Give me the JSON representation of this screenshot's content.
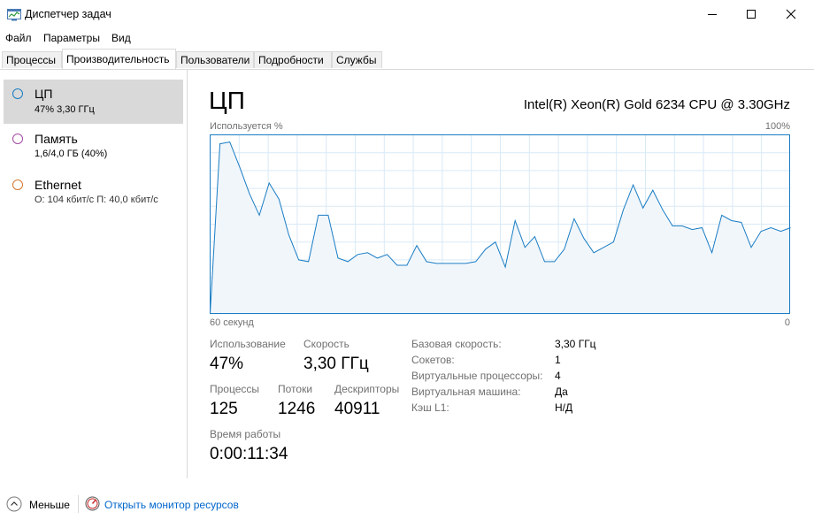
{
  "window": {
    "title": "Диспетчер задач"
  },
  "menu": [
    "Файл",
    "Параметры",
    "Вид"
  ],
  "tabs": [
    {
      "label": "Процессы",
      "active": false
    },
    {
      "label": "Производительность",
      "active": true
    },
    {
      "label": "Пользователи",
      "active": false
    },
    {
      "label": "Подробности",
      "active": false
    },
    {
      "label": "Службы",
      "active": false
    }
  ],
  "sidebar": {
    "items": [
      {
        "name": "ЦП",
        "detail": "47% 3,30 ГГц",
        "color": "#1a7dc4",
        "selected": true
      },
      {
        "name": "Память",
        "detail": "1,6/4,0 ГБ (40%)",
        "color": "#a349a4",
        "selected": false
      },
      {
        "name": "Ethernet",
        "detail": "О: 104 кбит/с П: 40,0 кбит/с",
        "color": "#d47630",
        "selected": false
      }
    ]
  },
  "main": {
    "title": "ЦП",
    "cpu_model": "Intel(R) Xeon(R) Gold 6234 CPU @ 3.30GHz",
    "graph": {
      "ylabel": "Используется %",
      "ymax_label": "100%",
      "xleft_label": "60 секунд",
      "xright_label": "0"
    },
    "stats": {
      "usage_label": "Использование",
      "usage_value": "47%",
      "speed_label": "Скорость",
      "speed_value": "3,30 ГГц",
      "processes_label": "Процессы",
      "processes_value": "125",
      "threads_label": "Потоки",
      "threads_value": "1246",
      "handles_label": "Дескрипторы",
      "handles_value": "40911",
      "uptime_label": "Время работы",
      "uptime_value": "0:00:11:34"
    },
    "specs": [
      {
        "label": "Базовая скорость:",
        "value": "3,30 ГГц"
      },
      {
        "label": "Сокетов:",
        "value": "1"
      },
      {
        "label": "Виртуальные процессоры:",
        "value": "4"
      },
      {
        "label": "Виртуальная машина:",
        "value": "Да"
      },
      {
        "label": "Кэш L1:",
        "value": "Н/Д"
      }
    ]
  },
  "footer": {
    "less_label": "Меньше",
    "resmon_label": "Открыть монитор ресурсов"
  },
  "chart_data": {
    "type": "area",
    "ylim": [
      0,
      100
    ],
    "xlim": [
      60,
      0
    ],
    "color": "#1a7dc4",
    "fill": "#f1f6fb",
    "values": [
      0,
      95,
      96,
      82,
      67,
      55,
      73,
      64,
      44,
      30,
      29,
      55,
      55,
      31,
      29,
      33,
      34,
      31,
      33,
      27,
      27,
      38,
      29,
      28,
      28,
      28,
      28,
      29,
      36,
      40,
      26,
      52,
      37,
      43,
      29,
      29,
      36,
      53,
      42,
      34,
      37,
      40,
      58,
      72,
      59,
      69,
      58,
      49,
      49,
      47,
      48,
      34,
      55,
      52,
      51,
      37,
      46,
      48,
      46,
      48
    ]
  }
}
